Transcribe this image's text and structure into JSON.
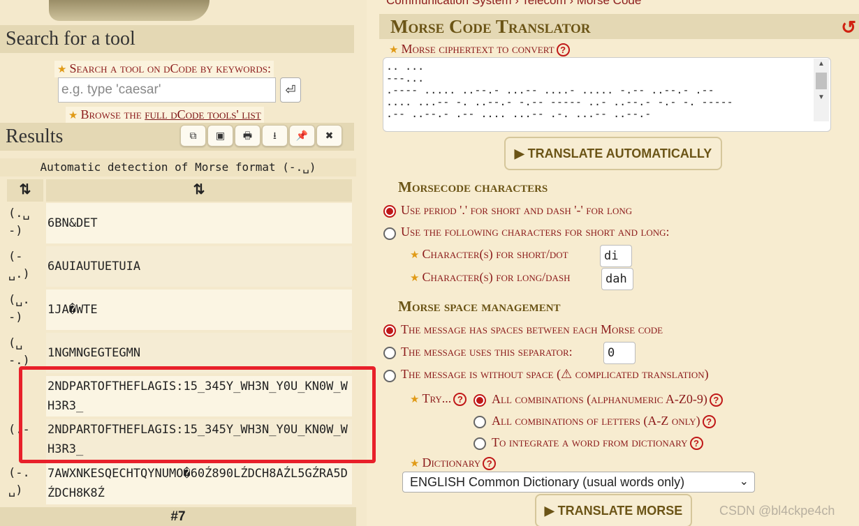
{
  "left": {
    "search_title": "Search for a tool",
    "search_hint": "Search a tool on dCode by keywords:",
    "search_placeholder": "e.g. type 'caesar'",
    "search_go": "⏎",
    "browse_prefix": "Browse the ",
    "browse_link": "full dCode tools' list",
    "results_title": "Results",
    "result_tools": [
      "⧉",
      "▣",
      "🖶",
      "⭳",
      "📌",
      "✖"
    ],
    "detection": "Automatic detection of Morse format (-.␣)",
    "col1": "⇅",
    "col2": "⇅",
    "rows": [
      {
        "key": "(.␣-)",
        "value": "6BN&DET"
      },
      {
        "key": "(-␣.)",
        "value": "6AUIAUTUETUIA"
      },
      {
        "key": "(␣.-)",
        "value": "1JA�WTE"
      },
      {
        "key": "(␣-.)",
        "value": "1NGMNGEGTEGMN"
      },
      {
        "key": "",
        "value": "2NDPARTOFTHEFLAGIS:15_345Y_WH3N_Y0U_KN0W_WH3R3_"
      },
      {
        "key": "(.-",
        "value": "2NDPARTOFTHEFLAGIS:15_345Y_WH3N_Y0U_KN0W_WH3R3_"
      },
      {
        "key": "(-.␣)",
        "value": "7AWXNKESQECHTQYNUMO�60Ź890LŹDCH8AŹL5GŹRA5DŹDCH8K8Ź"
      }
    ],
    "page_count": "#7"
  },
  "right": {
    "breadcrumb": "Communication System › Telecom › Morse Code",
    "title": "Morse Code Translator",
    "reset": "↺",
    "cipher_label": "Morse ciphertext to convert",
    "cipher_text": ".. ...\n---...\n.---- ..... ..--.- ...-- ....- ..... -.-- ..--.- .--\n.... ...-- -. ..--.- -.-- ----- ..- ..--.- -.- -. -----\n.-- ..--.- .-- .... ...-- .-. ...-- ..--.-",
    "btn_auto": "▶ TRANSLATE AUTOMATICALLY",
    "sec_chars": "Morsecode characters",
    "opt_period": "Use period '.' for short and dash '-' for long",
    "opt_custom": "Use the following characters for short and long:",
    "short_label": "Character(s) for short/dot",
    "short_value": "di",
    "long_label": "Character(s) for long/dash",
    "long_value": "dah",
    "sec_space": "Morse space management",
    "opt_spaces": "The message has spaces between each Morse code",
    "opt_separator": "The message uses this separator:",
    "separator_value": "0",
    "opt_nospace": "The message is without space (⚠ complicated translation)",
    "try_label": "Try...",
    "try_all": "All combinations (alphanumeric A-Z0-9)",
    "try_letters": "All combinations of letters (A-Z only)",
    "try_dict": "To integrate a word from dictionary",
    "dict_label": "Dictionary",
    "dict_value": "ENGLISH Common Dictionary (usual words only)",
    "btn_translate": "▶ TRANSLATE MORSE"
  },
  "watermark": "CSDN @bl4ckpe4ch"
}
